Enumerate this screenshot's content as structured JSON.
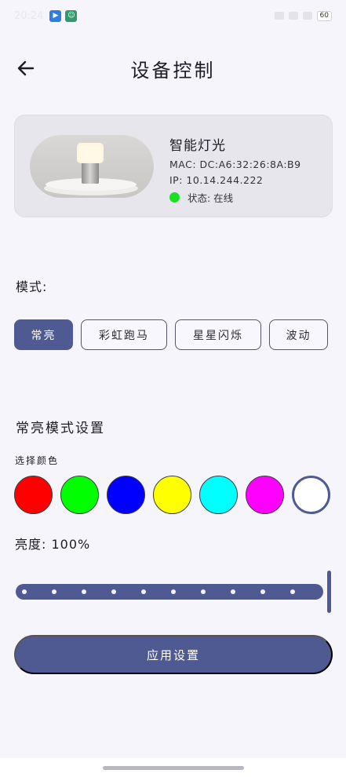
{
  "status_bar": {
    "time": "20:24",
    "battery": "60"
  },
  "header": {
    "title": "设备控制"
  },
  "device": {
    "name": "智能灯光",
    "mac": "MAC: DC:A6:32:26:8A:B9",
    "ip": "IP: 10.14.244.222",
    "status": "状态: 在线",
    "status_color": "#16e01f"
  },
  "mode": {
    "label": "模式:",
    "options": [
      "常亮",
      "彩虹跑马",
      "星星闪烁",
      "波动"
    ],
    "active": "常亮"
  },
  "settings": {
    "title": "常亮模式设置",
    "color_label": "选择颜色",
    "colors": [
      "#ff0000",
      "#00ff00",
      "#0000ff",
      "#ffff00",
      "#00ffff",
      "#ff00ff",
      "#ffffff"
    ],
    "selected_color": "#ffffff",
    "brightness_label": "亮度: 100%",
    "brightness": 100
  },
  "apply_label": "应用设置",
  "theme": {
    "accent": "#4f5a92",
    "background": "#f6f5fc"
  }
}
